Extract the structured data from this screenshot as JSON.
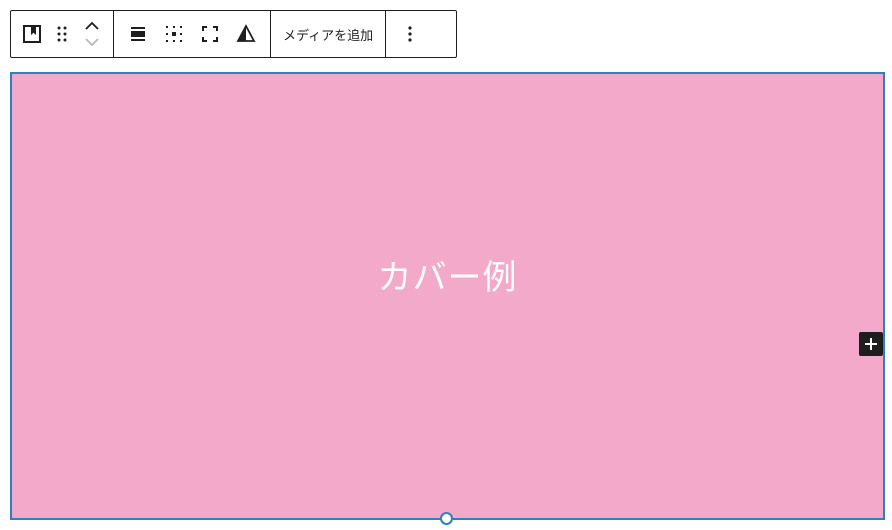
{
  "toolbar": {
    "block_type_icon": "cover-block-icon",
    "drag_icon": "drag-handle-icon",
    "move_up_icon": "chevron-up-icon",
    "move_down_icon": "chevron-down-icon",
    "align_icon": "align-wide-icon",
    "content_position_icon": "matrix-position-icon",
    "fullscreen_icon": "full-height-icon",
    "duotone_icon": "duotone-filter-icon",
    "add_media_label": "メディアを追加",
    "more_options_icon": "more-vertical-icon"
  },
  "cover": {
    "title": "カバー例",
    "background_color": "#f2a9ca",
    "selection_color": "#2f7fbf"
  },
  "inserter": {
    "icon": "plus-icon"
  }
}
